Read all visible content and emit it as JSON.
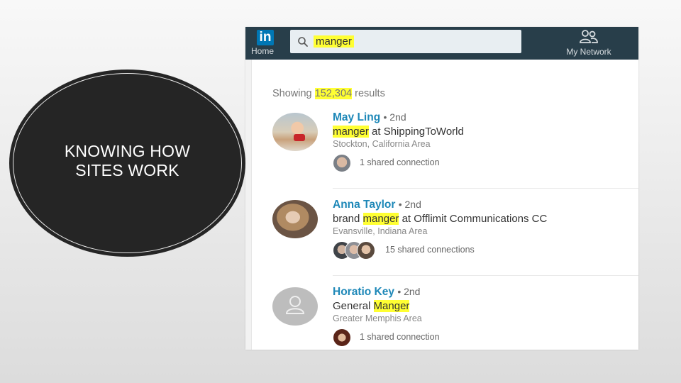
{
  "slide": {
    "title_lines": [
      "KNOWING HOW",
      "SITES WORK"
    ]
  },
  "linkedin": {
    "nav": {
      "logo_text": "in",
      "home_label": "Home",
      "search_icon": "search-icon",
      "search_value": "manger",
      "network_icon": "people-icon",
      "network_label": "My Network"
    },
    "results_prefix": "Showing",
    "results_count": "152,304",
    "results_suffix": "results",
    "results": [
      {
        "name": "May Ling",
        "degree": "• 2nd",
        "headline_before": "",
        "headline_highlight": "manger",
        "headline_after": " at ShippingToWorld",
        "location": "Stockton, California Area",
        "shared": "1 shared connection",
        "avatar": "photo-avatar"
      },
      {
        "name": "Anna Taylor",
        "degree": "• 2nd",
        "headline_before": "brand ",
        "headline_highlight": "manger",
        "headline_after": " at Offlimit Communications CC",
        "location": "Evansville, Indiana Area",
        "shared": "15 shared connections",
        "avatar": "photo-avatar"
      },
      {
        "name": "Horatio Key",
        "degree": "• 2nd",
        "headline_before": "General ",
        "headline_highlight": "Manger",
        "headline_after": "",
        "location": "Greater Memphis Area",
        "shared": "1 shared connection",
        "avatar": "placeholder-avatar"
      }
    ],
    "colors": {
      "navbar": "#283e4a",
      "brand_blue": "#0077b5",
      "name_blue": "#1e88b8",
      "highlight": "#ffff33"
    }
  }
}
